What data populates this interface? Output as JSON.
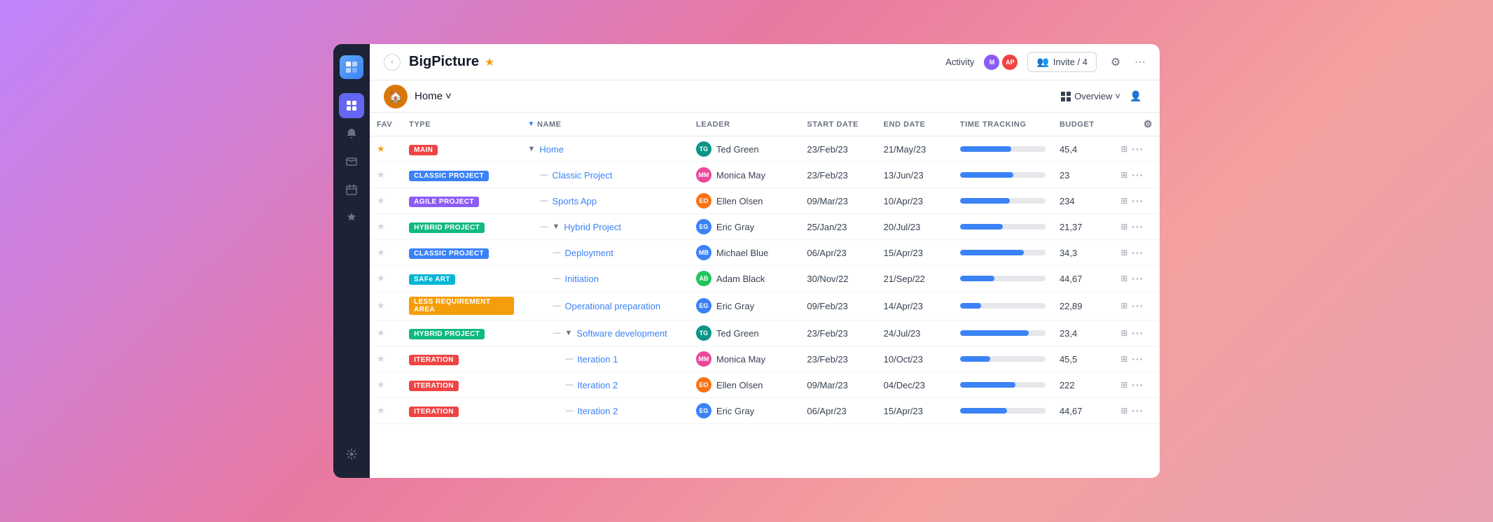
{
  "app": {
    "title": "BigPicture",
    "collapse_btn": "‹",
    "star": "★"
  },
  "header": {
    "activity_label": "Activity",
    "avatar1_initials": "AP",
    "avatar2_initials": "M",
    "invite_label": "Invite / 4",
    "gear_icon": "⚙",
    "more_icon": "···"
  },
  "subheader": {
    "home_icon": "🏠",
    "home_label": "Home",
    "chevron": "˅",
    "overview_label": "Overview",
    "overview_chevron": "˅",
    "user_icon": "👤"
  },
  "table": {
    "columns": {
      "fav": "FAV",
      "type": "TYPE",
      "name": "NAME",
      "leader": "LEADER",
      "start_date": "START DATE",
      "end_date": "END DATE",
      "time_tracking": "TIME TRACKING",
      "budget": "BUDGET"
    },
    "rows": [
      {
        "fav": true,
        "badge_type": "main",
        "badge_label": "MAIN",
        "indent": 0,
        "expand": true,
        "name": "Home",
        "leader_initials": "TG",
        "leader_name": "Ted Green",
        "leader_color": "av-teal",
        "start_date": "23/Feb/23",
        "end_date": "21/May/23",
        "progress": 60,
        "budget": "45,4"
      },
      {
        "fav": false,
        "badge_type": "classic",
        "badge_label": "CLASSIC PROJECT",
        "indent": 1,
        "expand": false,
        "name": "Classic Project",
        "leader_initials": "MM",
        "leader_name": "Monica May",
        "leader_color": "av-pink",
        "start_date": "23/Feb/23",
        "end_date": "13/Jun/23",
        "progress": 62,
        "budget": "23"
      },
      {
        "fav": false,
        "badge_type": "agile",
        "badge_label": "AGILE PROJECT",
        "indent": 1,
        "expand": false,
        "name": "Sports App",
        "leader_initials": "EO",
        "leader_name": "Ellen Olsen",
        "leader_color": "av-orange",
        "start_date": "09/Mar/23",
        "end_date": "10/Apr/23",
        "progress": 58,
        "budget": "234"
      },
      {
        "fav": false,
        "badge_type": "hybrid",
        "badge_label": "HYBRID PROJECT",
        "indent": 1,
        "expand": true,
        "name": "Hybrid Project",
        "leader_initials": "EG",
        "leader_name": "Eric Gray",
        "leader_color": "av-blue",
        "start_date": "25/Jan/23",
        "end_date": "20/Jul/23",
        "progress": 50,
        "budget": "21,37"
      },
      {
        "fav": false,
        "badge_type": "classic",
        "badge_label": "CLASSIC PROJECT",
        "indent": 2,
        "expand": false,
        "name": "Deployment",
        "leader_initials": "MB",
        "leader_name": "Michael Blue",
        "leader_color": "av-blue",
        "start_date": "06/Apr/23",
        "end_date": "15/Apr/23",
        "progress": 75,
        "budget": "34,3"
      },
      {
        "fav": false,
        "badge_type": "safe",
        "badge_label": "SAFe ART",
        "indent": 2,
        "expand": false,
        "name": "Initiation",
        "leader_initials": "AB",
        "leader_name": "Adam Black",
        "leader_color": "av-green",
        "start_date": "30/Nov/22",
        "end_date": "21/Sep/22",
        "progress": 40,
        "budget": "44,67"
      },
      {
        "fav": false,
        "badge_type": "less",
        "badge_label": "LESS REQUIREMENT AREA",
        "indent": 2,
        "expand": false,
        "name": "Operational preparation",
        "leader_initials": "EG",
        "leader_name": "Eric Gray",
        "leader_color": "av-blue",
        "start_date": "09/Feb/23",
        "end_date": "14/Apr/23",
        "progress": 25,
        "budget": "22,89"
      },
      {
        "fav": false,
        "badge_type": "hybrid",
        "badge_label": "HYBRID PROJECT",
        "indent": 2,
        "expand": true,
        "name": "Software development",
        "leader_initials": "TG",
        "leader_name": "Ted Green",
        "leader_color": "av-teal",
        "start_date": "23/Feb/23",
        "end_date": "24/Jul/23",
        "progress": 80,
        "budget": "23,4"
      },
      {
        "fav": false,
        "badge_type": "iteration",
        "badge_label": "ITERATION",
        "indent": 3,
        "expand": false,
        "name": "Iteration 1",
        "leader_initials": "MM",
        "leader_name": "Monica May",
        "leader_color": "av-pink",
        "start_date": "23/Feb/23",
        "end_date": "10/Oct/23",
        "progress": 35,
        "budget": "45,5"
      },
      {
        "fav": false,
        "badge_type": "iteration",
        "badge_label": "ITERATION",
        "indent": 3,
        "expand": false,
        "name": "Iteration 2",
        "leader_initials": "EO",
        "leader_name": "Ellen Olsen",
        "leader_color": "av-orange",
        "start_date": "09/Mar/23",
        "end_date": "04/Dec/23",
        "progress": 65,
        "budget": "222"
      },
      {
        "fav": false,
        "badge_type": "iteration",
        "badge_label": "ITERATION",
        "indent": 3,
        "expand": false,
        "name": "Iteration 2",
        "leader_initials": "EG",
        "leader_name": "Eric Gray",
        "leader_color": "av-blue",
        "start_date": "06/Apr/23",
        "end_date": "15/Apr/23",
        "progress": 55,
        "budget": "44,67"
      }
    ]
  }
}
